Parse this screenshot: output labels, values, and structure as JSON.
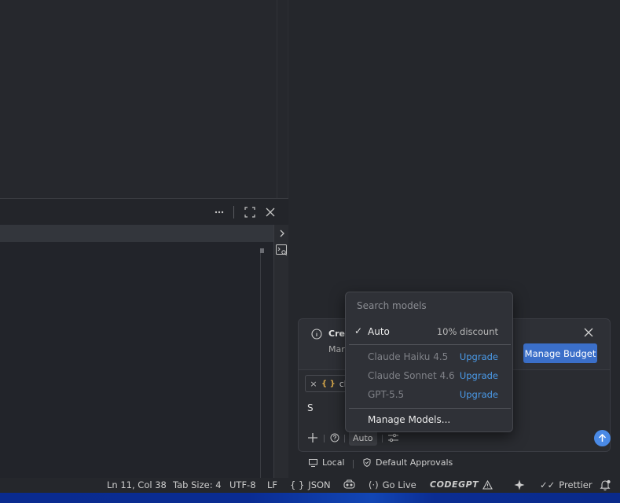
{
  "panel_header": {
    "more_icon": "ellipsis-icon",
    "maximize_icon": "maximize-icon",
    "close_icon": "close-icon"
  },
  "side_strip": {
    "expand_icon": "chevron-right-icon",
    "terminal_icon": "terminal-search-icon"
  },
  "banner": {
    "title": "Crec",
    "subtitle": "Mar",
    "manage_budget_label": "Manage Budget"
  },
  "chat_input": {
    "context_chip_label": "cha",
    "typed_text": "S",
    "model_button_label": "Auto"
  },
  "under_input": {
    "local_label": "Local",
    "approvals_label": "Default Approvals"
  },
  "model_dropdown": {
    "search_placeholder": "Search models",
    "selected": {
      "name": "Auto",
      "note": "10% discount"
    },
    "models": [
      {
        "name": "Claude Haiku 4.5",
        "action": "Upgrade"
      },
      {
        "name": "Claude Sonnet 4.6",
        "action": "Upgrade"
      },
      {
        "name": "GPT-5.5",
        "action": "Upgrade"
      }
    ],
    "manage_label": "Manage Models..."
  },
  "statusbar": {
    "position": "Ln 11, Col 38",
    "tab_size": "Tab Size: 4",
    "encoding": "UTF-8",
    "eol": "LF",
    "language_braces": "{ }",
    "language": "JSON",
    "go_live": "Go Live",
    "codegpt": "CODEGPT",
    "prettier": "Prettier"
  },
  "colors": {
    "accent": "#3b6fc9",
    "link": "#4a9ae8",
    "send": "#4a8ae6"
  }
}
